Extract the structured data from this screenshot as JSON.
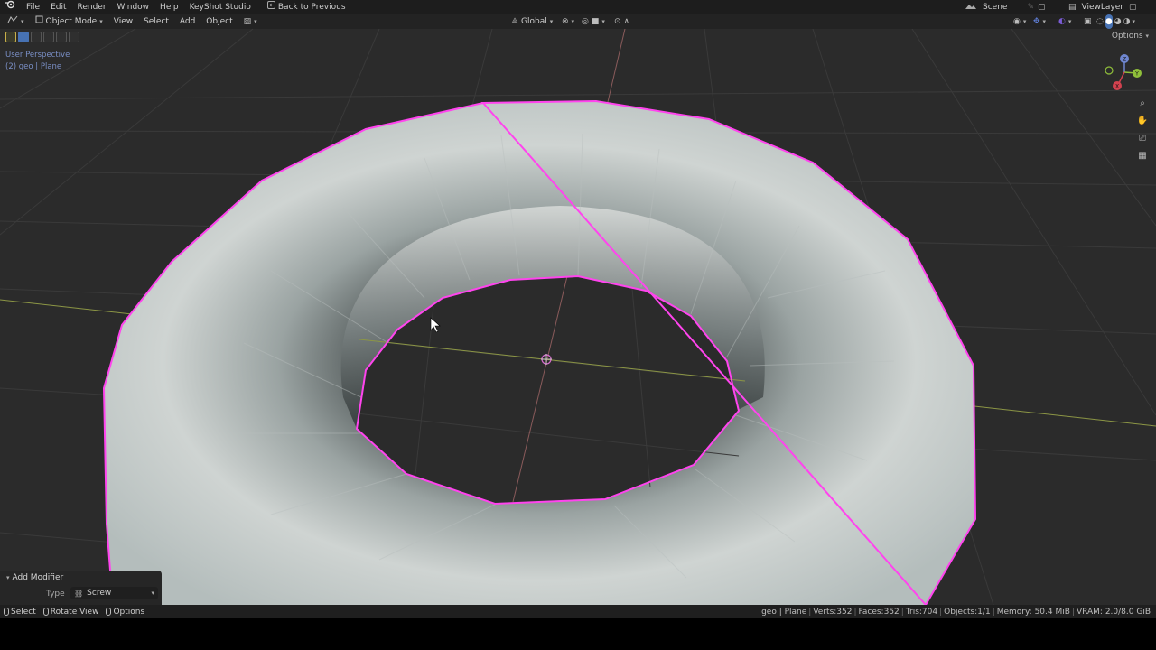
{
  "menu": {
    "logo": "blender-logo",
    "items": [
      "File",
      "Edit",
      "Render",
      "Window",
      "Help",
      "KeyShot Studio"
    ],
    "back_button": "Back to Previous"
  },
  "scene": {
    "name": "Scene",
    "view_layer": "ViewLayer"
  },
  "header": {
    "mode": "Object Mode",
    "items": [
      "View",
      "Select",
      "Add",
      "Object"
    ],
    "transform_orientation": "Global",
    "options": "Options"
  },
  "overlay": {
    "view_name": "User Perspective",
    "object_info": "(2) geo | Plane"
  },
  "gizmo": {
    "z": "Z",
    "y": "Y",
    "x": "X"
  },
  "modifier_panel": {
    "title": "Add Modifier",
    "type_label": "Type",
    "type_value": "Screw"
  },
  "statusbar": {
    "hints": [
      "Select",
      "Rotate View",
      "Options"
    ],
    "stats": [
      "geo | Plane",
      "Verts:352",
      "Faces:352",
      "Tris:704",
      "Objects:1/1",
      "Memory: 50.4 MiB",
      "VRAM: 2.0/8.0 GiB"
    ]
  },
  "colors": {
    "selection_outline": "#ff44ee",
    "x_axis": "#b8c45c",
    "y_axis": "#d48a8a",
    "background": "#2b2b2b"
  }
}
